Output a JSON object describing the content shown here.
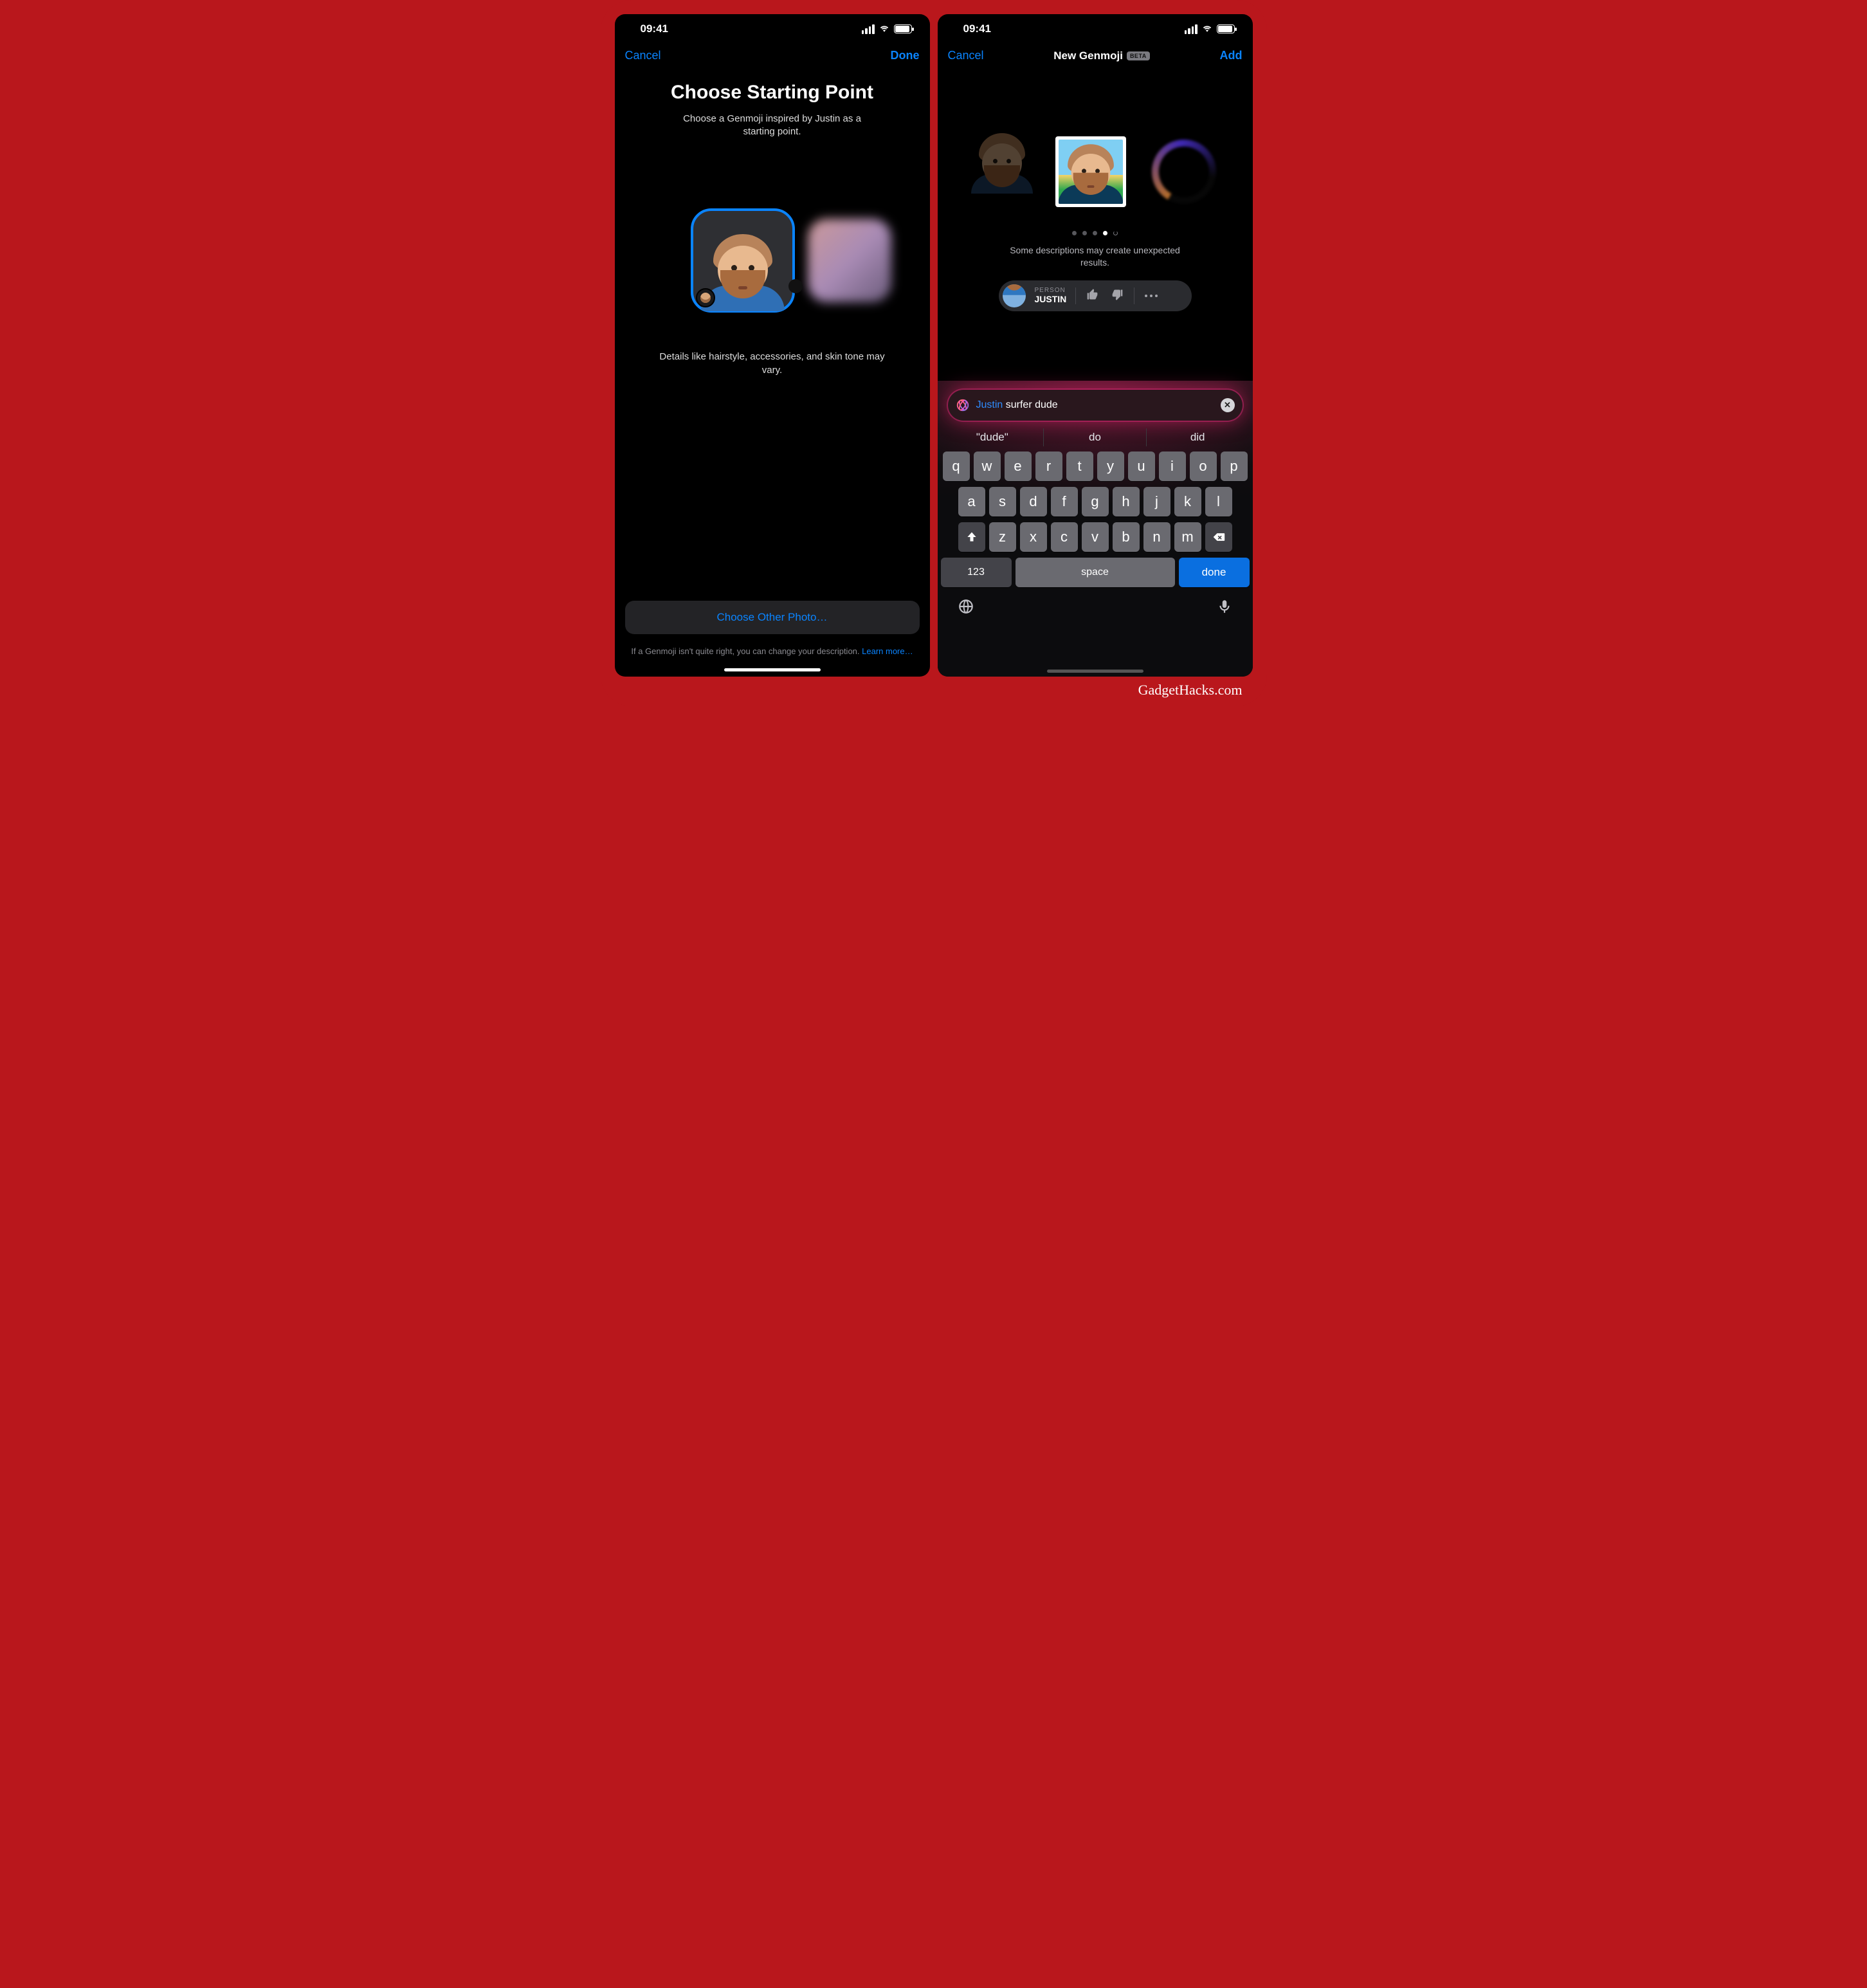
{
  "status": {
    "time": "09:41"
  },
  "screen1": {
    "nav": {
      "cancel": "Cancel",
      "done": "Done"
    },
    "title": "Choose Starting Point",
    "subtitle": "Choose a Genmoji inspired by Justin as a starting point.",
    "note": "Details like hairstyle, accessories, and skin tone may vary.",
    "other_button": "Choose Other Photo…",
    "footnote_text": "If a Genmoji isn't quite right, you can change your description. ",
    "footnote_link": "Learn more…"
  },
  "screen2": {
    "nav": {
      "cancel": "Cancel",
      "title": "New Genmoji",
      "badge": "BETA",
      "add": "Add"
    },
    "warning": "Some descriptions may create unexpected results.",
    "person_pill": {
      "label": "PERSON",
      "name": "JUSTIN"
    },
    "prompt": {
      "highlight": "Justin",
      "rest": " surfer dude"
    },
    "suggestions": [
      "\"dude\"",
      "do",
      "did"
    ],
    "keyboard": {
      "row1": [
        "q",
        "w",
        "e",
        "r",
        "t",
        "y",
        "u",
        "i",
        "o",
        "p"
      ],
      "row2": [
        "a",
        "s",
        "d",
        "f",
        "g",
        "h",
        "j",
        "k",
        "l"
      ],
      "row3": [
        "z",
        "x",
        "c",
        "v",
        "b",
        "n",
        "m"
      ],
      "numbers": "123",
      "space": "space",
      "done": "done"
    }
  },
  "credit": "GadgetHacks.com"
}
